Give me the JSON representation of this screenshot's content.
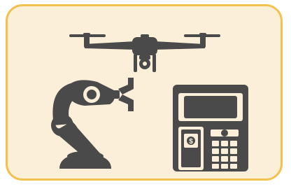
{
  "illustration": {
    "atm_label": "ATM",
    "icons": [
      "drone-icon",
      "robotic-arm-icon",
      "atm-icon"
    ],
    "colors": {
      "background": "#fcefd9",
      "border": "#f2c14e",
      "icon_dark": "#4a4a4a",
      "icon_light": "#fcefd9"
    }
  }
}
